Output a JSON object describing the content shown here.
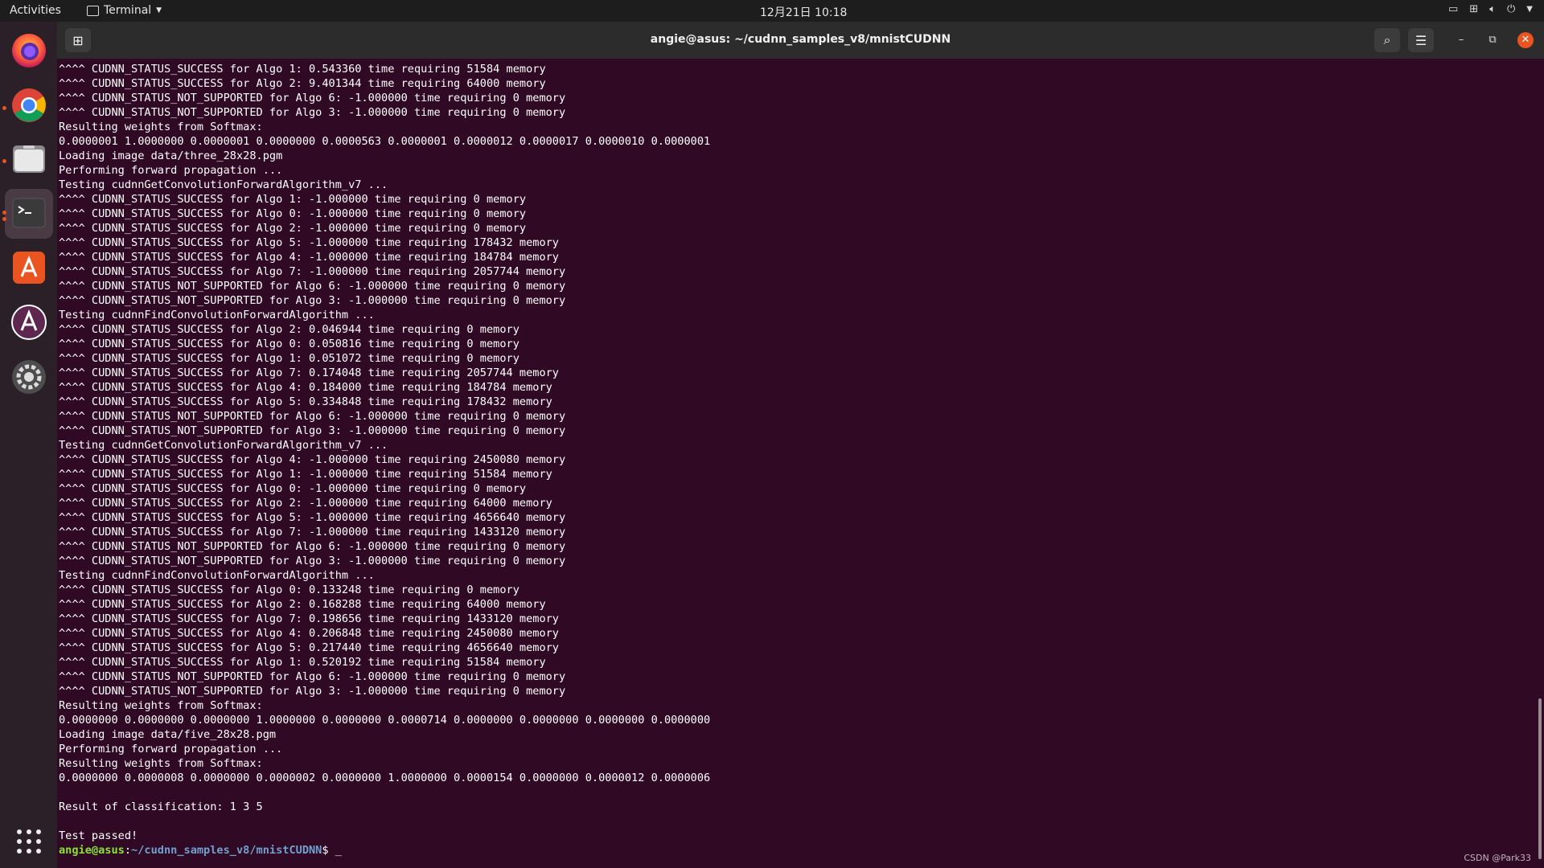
{
  "topbar": {
    "activities": "Activities",
    "app_name": "Terminal",
    "clock": "12月21日 10:18"
  },
  "dock": {
    "apps": [
      "Firefox",
      "Chrome",
      "Files",
      "Terminal",
      "Ubuntu Software",
      "Software Updater",
      "Settings",
      "Show Applications"
    ]
  },
  "window": {
    "title": "angie@asus: ~/cudnn_samples_v8/mnistCUDNN"
  },
  "terminal": {
    "lines": [
      "^^^^ CUDNN_STATUS_SUCCESS for Algo 1: 0.543360 time requiring 51584 memory",
      "^^^^ CUDNN_STATUS_SUCCESS for Algo 2: 9.401344 time requiring 64000 memory",
      "^^^^ CUDNN_STATUS_NOT_SUPPORTED for Algo 6: -1.000000 time requiring 0 memory",
      "^^^^ CUDNN_STATUS_NOT_SUPPORTED for Algo 3: -1.000000 time requiring 0 memory",
      "Resulting weights from Softmax:",
      "0.0000001 1.0000000 0.0000001 0.0000000 0.0000563 0.0000001 0.0000012 0.0000017 0.0000010 0.0000001",
      "Loading image data/three_28x28.pgm",
      "Performing forward propagation ...",
      "Testing cudnnGetConvolutionForwardAlgorithm_v7 ...",
      "^^^^ CUDNN_STATUS_SUCCESS for Algo 1: -1.000000 time requiring 0 memory",
      "^^^^ CUDNN_STATUS_SUCCESS for Algo 0: -1.000000 time requiring 0 memory",
      "^^^^ CUDNN_STATUS_SUCCESS for Algo 2: -1.000000 time requiring 0 memory",
      "^^^^ CUDNN_STATUS_SUCCESS for Algo 5: -1.000000 time requiring 178432 memory",
      "^^^^ CUDNN_STATUS_SUCCESS for Algo 4: -1.000000 time requiring 184784 memory",
      "^^^^ CUDNN_STATUS_SUCCESS for Algo 7: -1.000000 time requiring 2057744 memory",
      "^^^^ CUDNN_STATUS_NOT_SUPPORTED for Algo 6: -1.000000 time requiring 0 memory",
      "^^^^ CUDNN_STATUS_NOT_SUPPORTED for Algo 3: -1.000000 time requiring 0 memory",
      "Testing cudnnFindConvolutionForwardAlgorithm ...",
      "^^^^ CUDNN_STATUS_SUCCESS for Algo 2: 0.046944 time requiring 0 memory",
      "^^^^ CUDNN_STATUS_SUCCESS for Algo 0: 0.050816 time requiring 0 memory",
      "^^^^ CUDNN_STATUS_SUCCESS for Algo 1: 0.051072 time requiring 0 memory",
      "^^^^ CUDNN_STATUS_SUCCESS for Algo 7: 0.174048 time requiring 2057744 memory",
      "^^^^ CUDNN_STATUS_SUCCESS for Algo 4: 0.184000 time requiring 184784 memory",
      "^^^^ CUDNN_STATUS_SUCCESS for Algo 5: 0.334848 time requiring 178432 memory",
      "^^^^ CUDNN_STATUS_NOT_SUPPORTED for Algo 6: -1.000000 time requiring 0 memory",
      "^^^^ CUDNN_STATUS_NOT_SUPPORTED for Algo 3: -1.000000 time requiring 0 memory",
      "Testing cudnnGetConvolutionForwardAlgorithm_v7 ...",
      "^^^^ CUDNN_STATUS_SUCCESS for Algo 4: -1.000000 time requiring 2450080 memory",
      "^^^^ CUDNN_STATUS_SUCCESS for Algo 1: -1.000000 time requiring 51584 memory",
      "^^^^ CUDNN_STATUS_SUCCESS for Algo 0: -1.000000 time requiring 0 memory",
      "^^^^ CUDNN_STATUS_SUCCESS for Algo 2: -1.000000 time requiring 64000 memory",
      "^^^^ CUDNN_STATUS_SUCCESS for Algo 5: -1.000000 time requiring 4656640 memory",
      "^^^^ CUDNN_STATUS_SUCCESS for Algo 7: -1.000000 time requiring 1433120 memory",
      "^^^^ CUDNN_STATUS_NOT_SUPPORTED for Algo 6: -1.000000 time requiring 0 memory",
      "^^^^ CUDNN_STATUS_NOT_SUPPORTED for Algo 3: -1.000000 time requiring 0 memory",
      "Testing cudnnFindConvolutionForwardAlgorithm ...",
      "^^^^ CUDNN_STATUS_SUCCESS for Algo 0: 0.133248 time requiring 0 memory",
      "^^^^ CUDNN_STATUS_SUCCESS for Algo 2: 0.168288 time requiring 64000 memory",
      "^^^^ CUDNN_STATUS_SUCCESS for Algo 7: 0.198656 time requiring 1433120 memory",
      "^^^^ CUDNN_STATUS_SUCCESS for Algo 4: 0.206848 time requiring 2450080 memory",
      "^^^^ CUDNN_STATUS_SUCCESS for Algo 5: 0.217440 time requiring 4656640 memory",
      "^^^^ CUDNN_STATUS_SUCCESS for Algo 1: 0.520192 time requiring 51584 memory",
      "^^^^ CUDNN_STATUS_NOT_SUPPORTED for Algo 6: -1.000000 time requiring 0 memory",
      "^^^^ CUDNN_STATUS_NOT_SUPPORTED for Algo 3: -1.000000 time requiring 0 memory",
      "Resulting weights from Softmax:",
      "0.0000000 0.0000000 0.0000000 1.0000000 0.0000000 0.0000714 0.0000000 0.0000000 0.0000000 0.0000000",
      "Loading image data/five_28x28.pgm",
      "Performing forward propagation ...",
      "Resulting weights from Softmax:",
      "0.0000000 0.0000008 0.0000000 0.0000002 0.0000000 1.0000000 0.0000154 0.0000000 0.0000012 0.0000006",
      "",
      "Result of classification: 1 3 5",
      "",
      "Test passed!"
    ],
    "prompt_user": "angie@asus",
    "prompt_sep": ":",
    "prompt_path": "~/cudnn_samples_v8/mnistCUDNN",
    "prompt_tail": "$ _"
  },
  "watermark": "CSDN @Park33",
  "colors": {
    "terminal_bg": "#300a24",
    "prompt_user": "#8ae234",
    "prompt_path": "#729fcf",
    "accent": "#e95420"
  }
}
